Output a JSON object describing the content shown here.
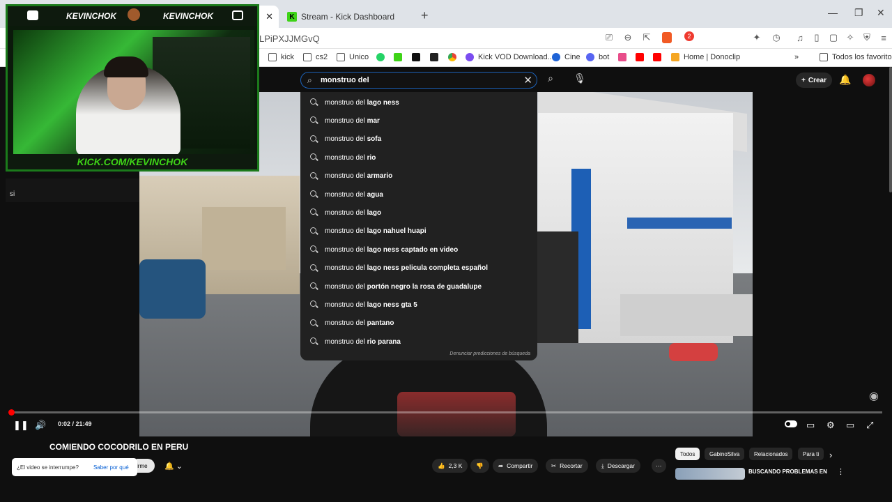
{
  "browser": {
    "tabs": [
      {
        "label": "",
        "active": true
      },
      {
        "label": "Stream - Kick Dashboard",
        "active": false
      }
    ],
    "url": "LPiPXJJMGvQ",
    "brave_badge": "2",
    "bookmarks": [
      {
        "label": "kick",
        "icon": "folder-icon"
      },
      {
        "label": "cs2",
        "icon": "folder-icon"
      },
      {
        "label": "Unico",
        "icon": "folder-icon"
      },
      {
        "label": "",
        "icon": "whatsapp-icon"
      },
      {
        "label": "",
        "icon": "kick-icon"
      },
      {
        "label": "",
        "icon": "tiktok-icon"
      },
      {
        "label": "",
        "icon": "capcut-icon"
      },
      {
        "label": "",
        "icon": "chrome-icon"
      },
      {
        "label": "Kick VOD Download...",
        "icon": "kick-vod-icon"
      },
      {
        "label": "Cine",
        "icon": "cine-icon"
      },
      {
        "label": "bot",
        "icon": "bot-icon"
      },
      {
        "label": "",
        "icon": "music-icon"
      },
      {
        "label": "",
        "icon": "youtube-icon"
      },
      {
        "label": "",
        "icon": "youtube-icon"
      },
      {
        "label": "Home | Donoclip",
        "icon": "donoclip-icon"
      }
    ],
    "all_bookmarks": "Todos los favoritos"
  },
  "youtube": {
    "search_value": "monstruo del",
    "create_label": "Crear",
    "suggestions": [
      {
        "prefix": "monstruo del",
        "rest": " lago ness"
      },
      {
        "prefix": "monstruo del",
        "rest": " mar"
      },
      {
        "prefix": "monstruo del",
        "rest": " sofa"
      },
      {
        "prefix": "monstruo del",
        "rest": " rio"
      },
      {
        "prefix": "monstruo del",
        "rest": " armario"
      },
      {
        "prefix": "monstruo del",
        "rest": " agua"
      },
      {
        "prefix": "monstruo del",
        "rest": " lago"
      },
      {
        "prefix": "monstruo del",
        "rest": " lago nahuel huapi"
      },
      {
        "prefix": "monstruo del",
        "rest": " lago ness captado en video"
      },
      {
        "prefix": "monstruo del",
        "rest": " lago ness pelicula completa español"
      },
      {
        "prefix": "monstruo del",
        "rest": " portón negro la rosa de guadalupe"
      },
      {
        "prefix": "monstruo del",
        "rest": " lago ness gta 5"
      },
      {
        "prefix": "monstruo del",
        "rest": " pantano"
      },
      {
        "prefix": "monstruo del",
        "rest": " rio parana"
      }
    ],
    "report_predictions": "Denunciar predicciones de búsqueda",
    "player": {
      "time": "0:02 / 21:49",
      "progress": 0.0015
    },
    "video_title": "COMIENDO COCODRILO EN PERU",
    "tooltip_text": "¿El video se interrumpe?",
    "tooltip_link": "Saber por qué",
    "subscribe_partial": "irme",
    "likes": "2,3 K",
    "share": "Compartir",
    "clip": "Recortar",
    "download": "Descargar",
    "chips": [
      "Todos",
      "GabinoSilva",
      "Relacionados",
      "Para ti"
    ],
    "related_title": "BUSCANDO PROBLEMAS EN"
  },
  "overlay": {
    "name_left": "KEVINCHOK",
    "name_right": "KEVINCHOK",
    "url": "KICK.COM/KEVINCHOK",
    "chat_user": "",
    "chat_msg": "si"
  }
}
